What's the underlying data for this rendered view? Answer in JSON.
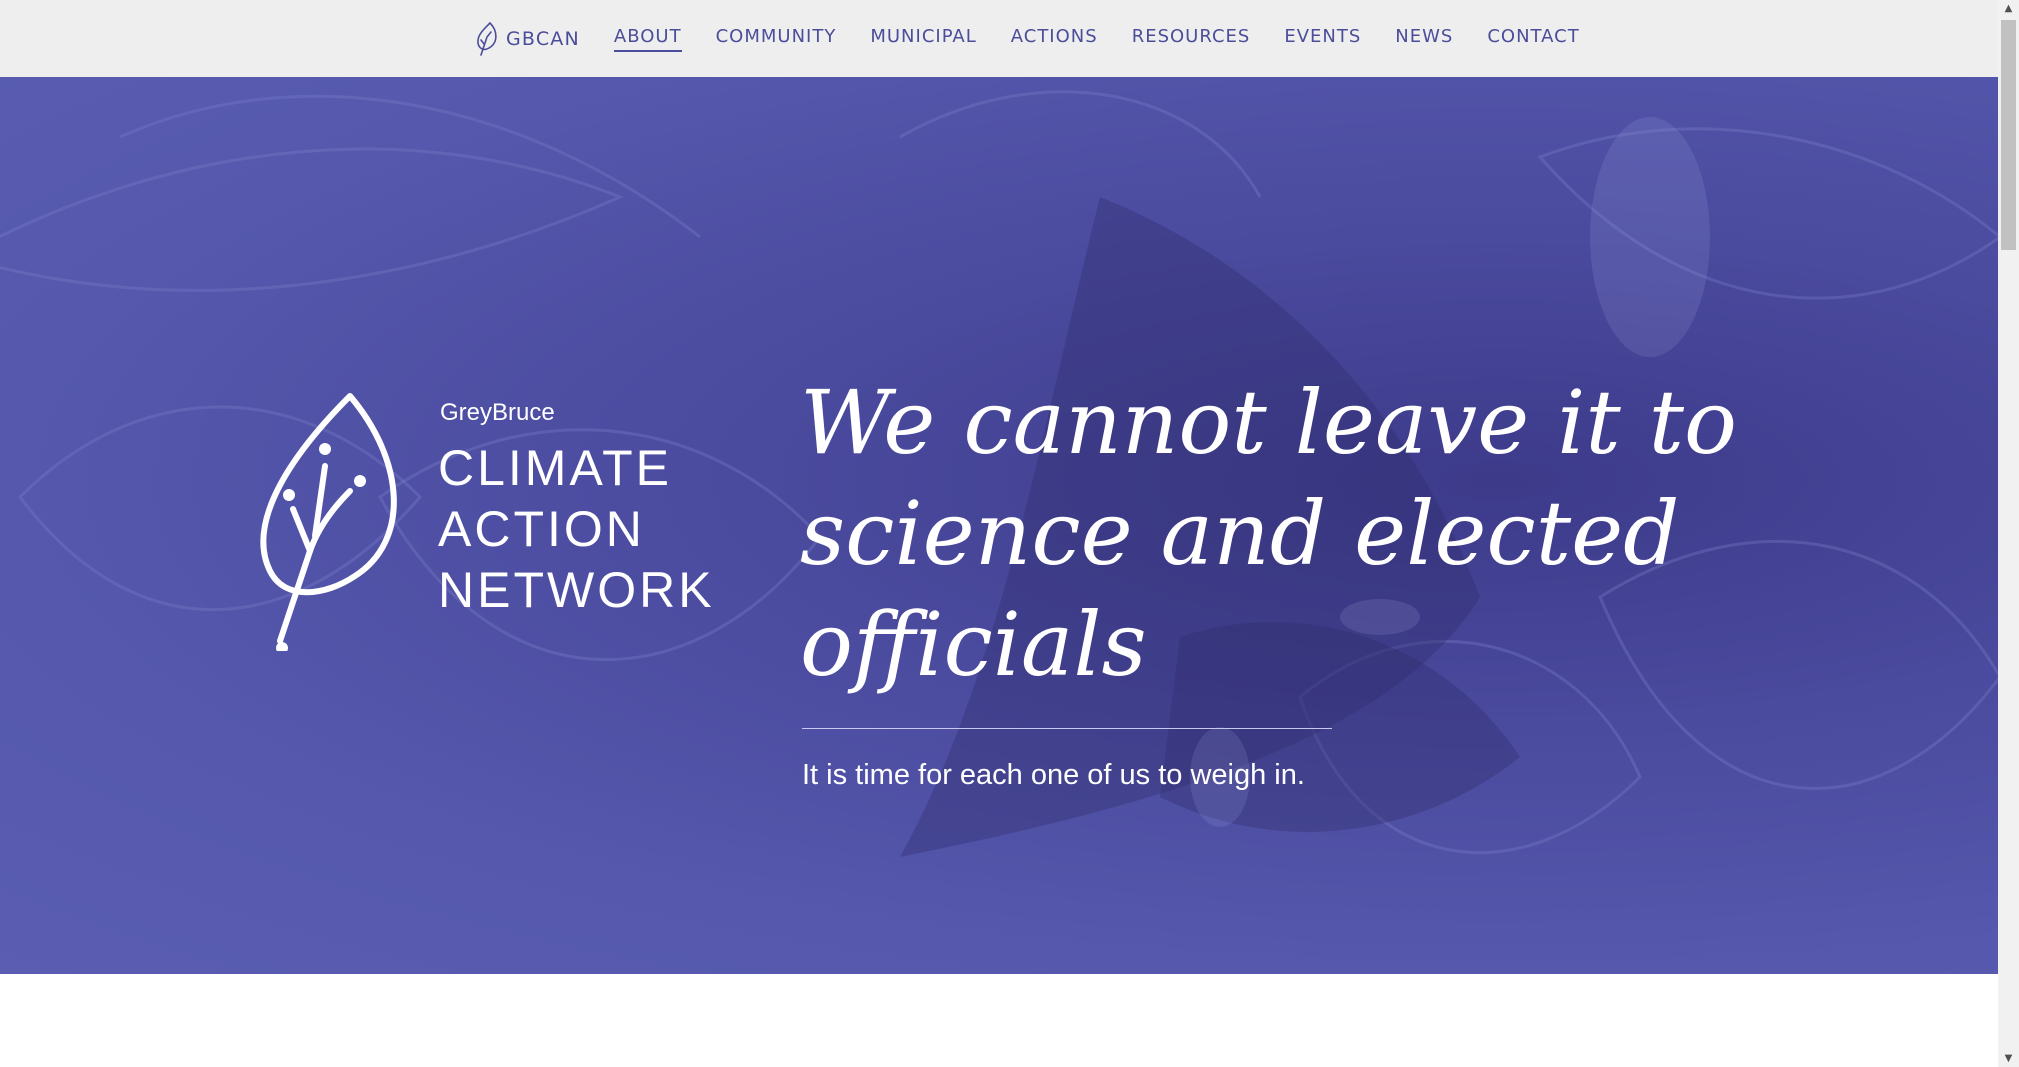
{
  "nav": {
    "brand": "GBCAN",
    "items": [
      {
        "label": "ABOUT",
        "active": true
      },
      {
        "label": "COMMUNITY",
        "active": false
      },
      {
        "label": "MUNICIPAL",
        "active": false
      },
      {
        "label": "ACTIONS",
        "active": false
      },
      {
        "label": "RESOURCES",
        "active": false
      },
      {
        "label": "EVENTS",
        "active": false
      },
      {
        "label": "NEWS",
        "active": false
      },
      {
        "label": "CONTACT",
        "active": false
      }
    ]
  },
  "hero": {
    "logo": {
      "small": "GreyBruce",
      "line1": "CLIMATE",
      "line2": "ACTION",
      "line3": "NETWORK"
    },
    "quote": {
      "line1": "We cannot leave it to",
      "line2": "science and elected",
      "line3": "officials"
    },
    "subtext": "It is time for each one of us to weigh in."
  },
  "colors": {
    "nav_bg": "#eeeeee",
    "nav_text": "#4b4d9a",
    "hero_tint": "#5558ad",
    "text_on_hero": "#ffffff"
  },
  "icons": {
    "brand": "leaf-icon",
    "logo": "leaf-logo-icon"
  }
}
